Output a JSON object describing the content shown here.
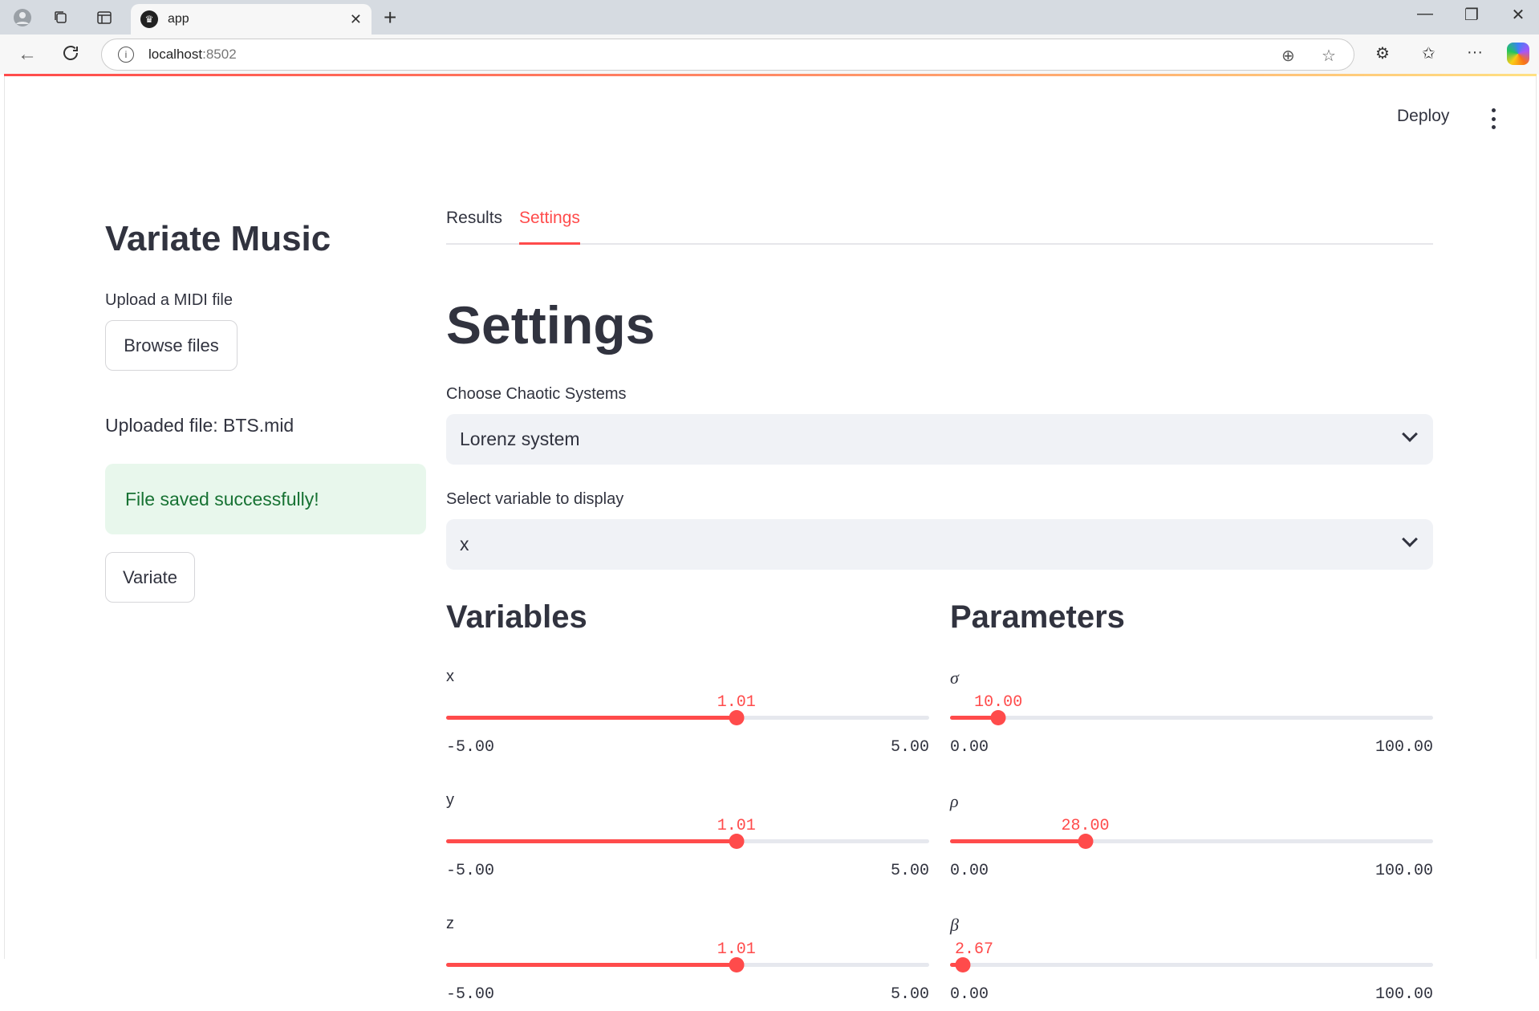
{
  "browser": {
    "tab_title": "app",
    "url_host": "localhost",
    "url_port": ":8502"
  },
  "header": {
    "deploy_label": "Deploy"
  },
  "sidebar": {
    "title": "Variate Music",
    "upload_label": "Upload a MIDI file",
    "browse_label": "Browse files",
    "uploaded_text": "Uploaded file: BTS.mid",
    "success_text": "File saved successfully!",
    "variate_label": "Variate"
  },
  "main": {
    "tabs": [
      {
        "label": "Results",
        "active": false
      },
      {
        "label": "Settings",
        "active": true
      }
    ],
    "heading": "Settings",
    "system_select": {
      "label": "Choose Chaotic Systems",
      "value": "Lorenz system"
    },
    "variable_select": {
      "label": "Select variable to display",
      "value": "x"
    },
    "variables": {
      "heading": "Variables",
      "sliders": [
        {
          "label": "x",
          "value": "1.01",
          "min": "-5.00",
          "max": "5.00",
          "fraction": 0.601
        },
        {
          "label": "y",
          "value": "1.01",
          "min": "-5.00",
          "max": "5.00",
          "fraction": 0.601
        },
        {
          "label": "z",
          "value": "1.01",
          "min": "-5.00",
          "max": "5.00",
          "fraction": 0.601
        }
      ]
    },
    "parameters": {
      "heading": "Parameters",
      "sliders": [
        {
          "label": "σ",
          "value": "10.00",
          "min": "0.00",
          "max": "100.00",
          "fraction": 0.1
        },
        {
          "label": "ρ",
          "value": "28.00",
          "min": "0.00",
          "max": "100.00",
          "fraction": 0.28
        },
        {
          "label": "β",
          "value": "2.67",
          "min": "0.00",
          "max": "100.00",
          "fraction": 0.0267
        }
      ]
    }
  },
  "colors": {
    "accent": "#ff4b4b",
    "success_bg": "#e8f7ec",
    "success_text": "#177233",
    "select_bg": "#f0f2f6"
  }
}
